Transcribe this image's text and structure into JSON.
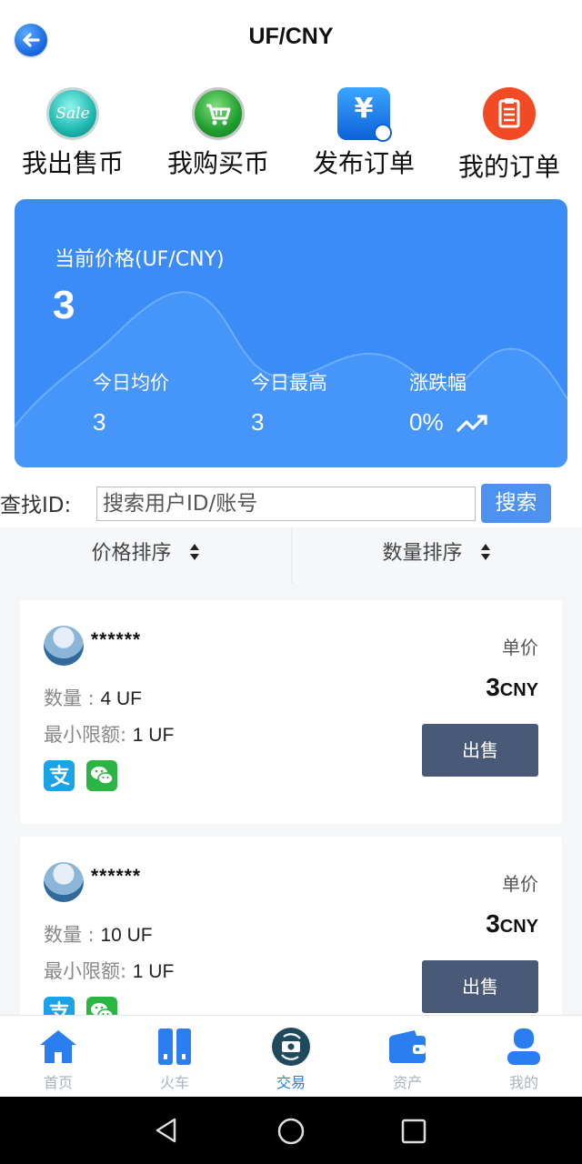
{
  "header": {
    "title": "UF/CNY",
    "back_icon": "back-arrow-icon"
  },
  "quick_actions": [
    {
      "label": "我出售币",
      "icon": "sale-icon",
      "icon_text": "Sale"
    },
    {
      "label": "我购买币",
      "icon": "cart-icon"
    },
    {
      "label": "发布订单",
      "icon": "yen-document-icon",
      "icon_text": "¥"
    },
    {
      "label": "我的订单",
      "icon": "clipboard-icon"
    }
  ],
  "price_card": {
    "label": "当前价格(UF/CNY)",
    "price": "3",
    "stats": [
      {
        "label": "今日均价",
        "value": "3"
      },
      {
        "label": "今日最高",
        "value": "3"
      },
      {
        "label": "涨跌幅",
        "value": "0%"
      }
    ],
    "trend_icon": "trending-up-icon",
    "color": "#3b8cf7"
  },
  "search": {
    "label": "查找ID:",
    "placeholder": "搜索用户ID/账号",
    "value": "",
    "button": "搜索"
  },
  "sort": {
    "price": "价格排序",
    "quantity": "数量排序"
  },
  "listings": [
    {
      "user": "******",
      "unit_label": "单价",
      "price": "3",
      "currency": "CNY",
      "qty_label": "数量 : ",
      "qty": "4 UF",
      "min_label": "最小限额: ",
      "min": "1 UF",
      "button": "出售",
      "payments": [
        "alipay-icon",
        "wechat-pay-icon"
      ]
    },
    {
      "user": "******",
      "unit_label": "单价",
      "price": "3",
      "currency": "CNY",
      "qty_label": "数量 : ",
      "qty": "10 UF",
      "min_label": "最小限额: ",
      "min": "1 UF",
      "button": "出售",
      "payments": [
        "alipay-icon",
        "wechat-pay-icon"
      ]
    }
  ],
  "bottom_nav": [
    {
      "label": "首页",
      "icon": "home-icon",
      "active": false
    },
    {
      "label": "火车",
      "icon": "train-icon",
      "active": false
    },
    {
      "label": "交易",
      "icon": "exchange-icon",
      "active": true
    },
    {
      "label": "资产",
      "icon": "wallet-icon",
      "active": false
    },
    {
      "label": "我的",
      "icon": "user-icon",
      "active": false
    }
  ],
  "colors": {
    "accent": "#2a7ef0",
    "sell_button": "#485a78",
    "nav_inactive": "#aab3c0"
  }
}
